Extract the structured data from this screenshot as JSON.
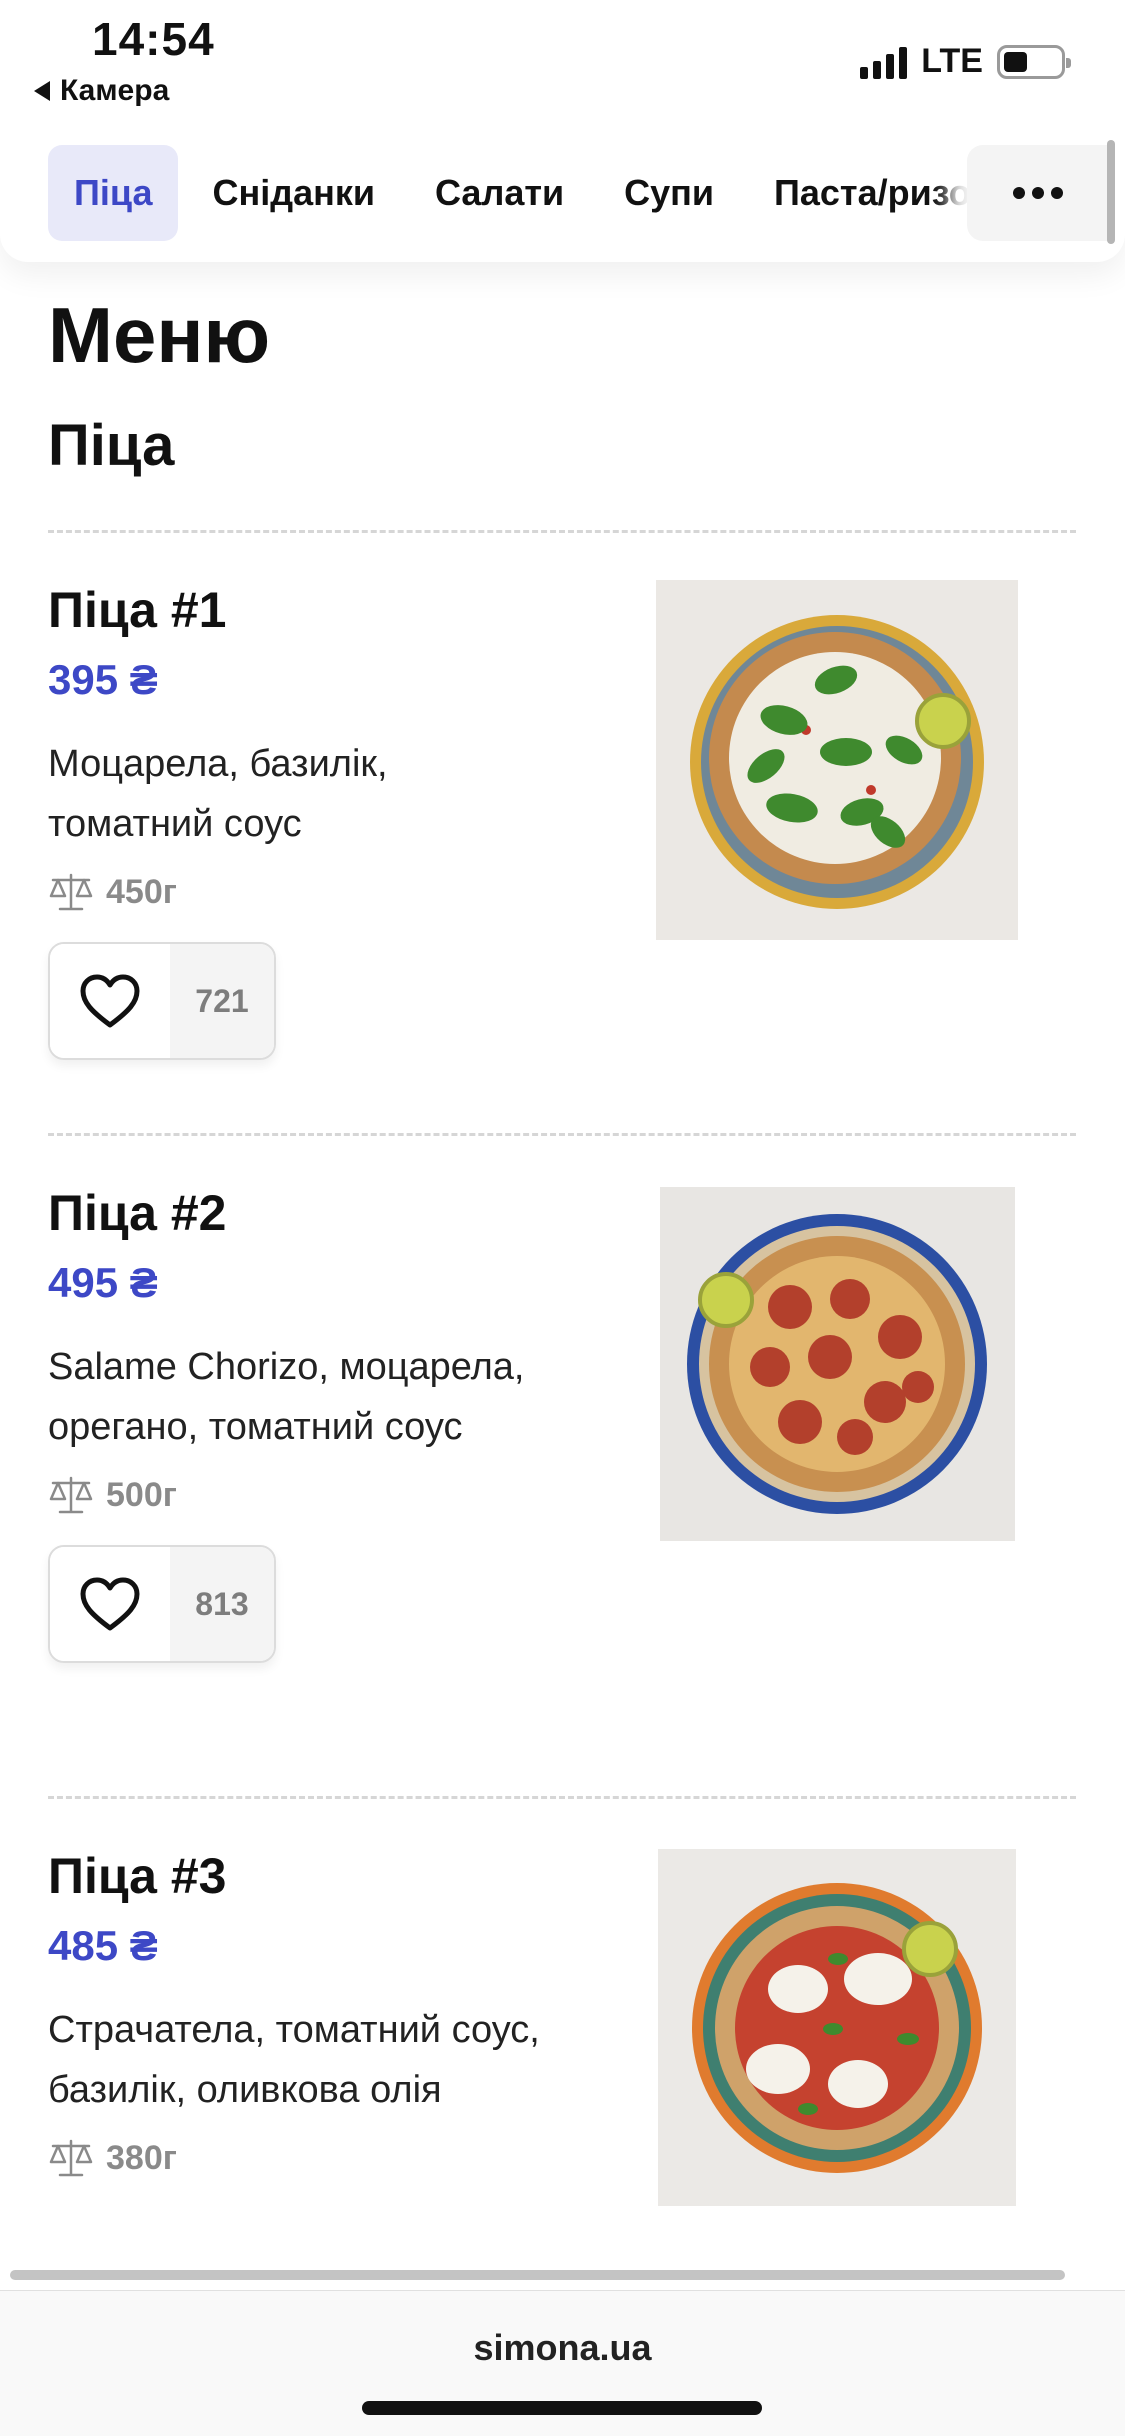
{
  "status_bar": {
    "time": "14:54",
    "back_label": "Камера",
    "network": "LTE"
  },
  "tabs": [
    {
      "label": "Піца",
      "active": true
    },
    {
      "label": "Сніданки",
      "active": false
    },
    {
      "label": "Салати",
      "active": false
    },
    {
      "label": "Супи",
      "active": false
    },
    {
      "label": "Паста/ризотто",
      "active": false
    }
  ],
  "menu": {
    "title": "Меню",
    "section_title": "Піца",
    "items": [
      {
        "name": "Піца #1",
        "price": "395 ₴",
        "description": "Моцарела, базилік, томатний соус",
        "weight": "450г",
        "likes": "721"
      },
      {
        "name": "Піца #2",
        "price": "495 ₴",
        "description": "Salame Chorizo, моцарела, орегано, томатний соус",
        "weight": "500г",
        "likes": "813"
      },
      {
        "name": "Піца #3",
        "price": "485 ₴",
        "description": "Страчатела, томатний соус, базилік, оливкова олія",
        "weight": "380г"
      }
    ]
  },
  "footer": {
    "domain": "simona.ua"
  },
  "colors": {
    "accent": "#3d48c6",
    "tab_active_bg": "#e8e9f9",
    "muted": "#8a8a8a"
  }
}
